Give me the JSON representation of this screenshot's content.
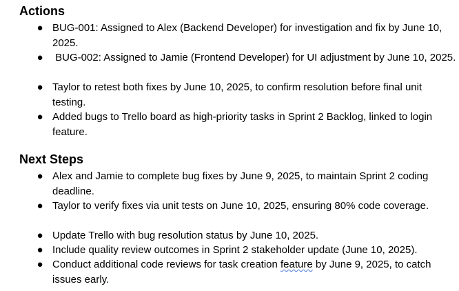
{
  "actions": {
    "heading": "Actions",
    "items": [
      "BUG-001: Assigned to Alex (Backend Developer) for investigation and fix by June 10, 2025.",
      " BUG-002: Assigned to Jamie (Frontend Developer) for UI adjustment by June 10, 2025.",
      "Taylor to retest both fixes by June 10, 2025, to confirm resolution before final unit testing.",
      "Added bugs to Trello board as high-priority tasks in Sprint 2 Backlog, linked to login feature."
    ]
  },
  "next_steps": {
    "heading": "Next Steps",
    "items": [
      "Alex and Jamie to complete bug fixes by June 9, 2025, to maintain Sprint 2 coding deadline.",
      "Taylor to verify fixes via unit tests on June 10, 2025, ensuring 80% code coverage.",
      "Update Trello with bug resolution status by June 10, 2025.",
      "Include quality review outcomes in Sprint 2 stakeholder update (June 10, 2025)."
    ],
    "last_item": {
      "before": "Conduct additional code reviews for task creation ",
      "flagged_word": "feature",
      "after": " by June 9, 2025, to catch issues early."
    }
  }
}
